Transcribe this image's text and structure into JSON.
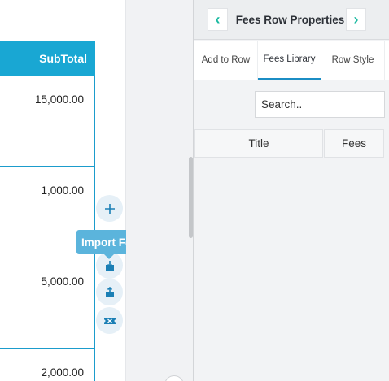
{
  "document": {
    "subtotal_header": "SubTotal",
    "rows": [
      "15,000.00",
      "1,000.00",
      "5,000.00",
      "2,000.00"
    ]
  },
  "gutter": {
    "tooltip": "Import Fee",
    "buttons": [
      "plus-icon",
      "import-icon",
      "export-icon",
      "fee-ticket-icon"
    ]
  },
  "panel": {
    "prev_label": "‹",
    "title": "Fees Row Properties",
    "next_label": "›",
    "tabs": [
      "Add to Row",
      "Fees Library",
      "Row Style"
    ],
    "active_tab": "Fees Library",
    "search": {
      "placeholder": "Search.."
    },
    "columns": [
      "Title",
      "Fees"
    ]
  },
  "colors": {
    "accent": "#19a7d3",
    "nav_arrow": "#19b9a0",
    "tooltip": "#5bb4dc"
  }
}
